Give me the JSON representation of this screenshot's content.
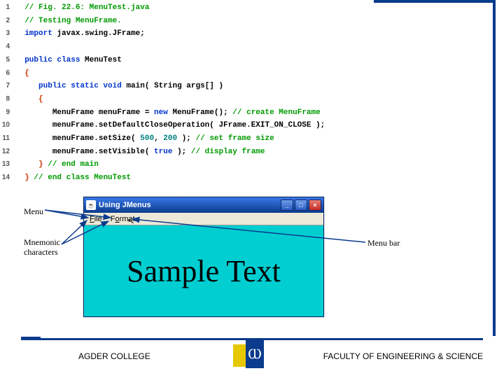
{
  "code": {
    "lines": [
      {
        "n": "1",
        "html": "<span class='cmt'>// Fig. 22.6: MenuTest.java</span>"
      },
      {
        "n": "2",
        "html": "<span class='cmt'>// Testing MenuFrame.</span>"
      },
      {
        "n": "3",
        "html": "<span class='kw'>import</span> <span class='id'>javax.swing.JFrame;</span>"
      },
      {
        "n": "4",
        "html": ""
      },
      {
        "n": "5",
        "html": "<span class='kw'>public class</span> <span class='id'>MenuTest</span>"
      },
      {
        "n": "6",
        "html": "<span class='op'>{</span>"
      },
      {
        "n": "7",
        "html": "   <span class='kw'>public static void</span> <span class='id'>main(</span> <span class='id'>String args[] )</span>"
      },
      {
        "n": "8",
        "html": "   <span class='op'>{</span>"
      },
      {
        "n": "9",
        "html": "      <span class='id'>MenuFrame menuFrame =</span> <span class='kw'>new</span> <span class='id'>MenuFrame();</span> <span class='cmt'>// create MenuFrame</span>"
      },
      {
        "n": "10",
        "html": "      <span class='id'>menuFrame.setDefaultCloseOperation( JFrame.EXIT_ON_CLOSE );</span>"
      },
      {
        "n": "11",
        "html": "      <span class='id'>menuFrame.setSize(</span> <span class='num'>500</span><span class='id'>,</span> <span class='num'>200</span> <span class='id'>);</span> <span class='cmt'>// set frame size</span>"
      },
      {
        "n": "12",
        "html": "      <span class='id'>menuFrame.setVisible(</span> <span class='kw'>true</span> <span class='id'>);</span> <span class='cmt'>// display frame</span>"
      },
      {
        "n": "13",
        "html": "   <span class='op'>}</span> <span class='cmt'>// end main</span>"
      },
      {
        "n": "14",
        "html": "<span class='op'>}</span> <span class='cmt'>// end class MenuTest</span>"
      }
    ]
  },
  "labels": {
    "menu": "Menu",
    "mnemonic_l1": "Mnemonic",
    "mnemonic_l2": "characters",
    "menubar": "Menu bar"
  },
  "window": {
    "title": "Using JMenus",
    "menus": {
      "file_pre": "F",
      "file_rest": "ile",
      "format_pre": "F",
      "format_mid": "o",
      "format_rest": "rmat"
    },
    "sample": "Sample Text"
  },
  "footer": {
    "left": "AGDER COLLEGE",
    "right": "FACULTY OF ENGINEERING & SCIENCE"
  }
}
